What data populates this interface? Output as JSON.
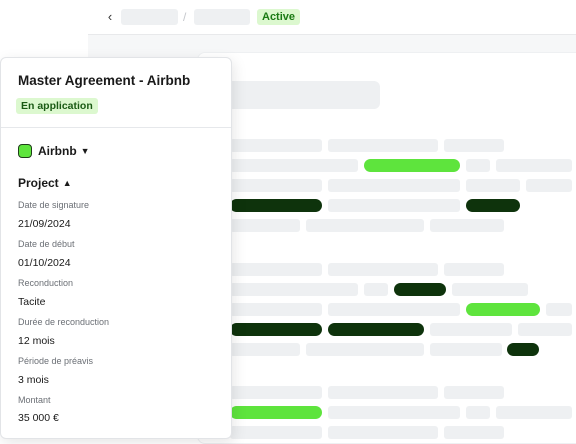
{
  "header": {
    "back_glyph": "‹",
    "breadcrumb_sep": "/",
    "status": "Active"
  },
  "panel": {
    "title": "Master Agreement - Airbnb",
    "badge": "En application",
    "company": {
      "name": "Airbnb",
      "icon": "company-logo-icon"
    },
    "section": {
      "label": "Project",
      "icon": "chevron-up-icon"
    },
    "fields": [
      {
        "label": "Date de signature",
        "value": "21/09/2024"
      },
      {
        "label": "Date de début",
        "value": "01/10/2024"
      },
      {
        "label": "Reconduction",
        "value": "Tacite"
      },
      {
        "label": "Durée de reconduction",
        "value": "12 mois"
      },
      {
        "label": "Période de préavis",
        "value": "3 mois"
      },
      {
        "label": "Montant",
        "value": "35 000 €"
      }
    ]
  },
  "colors": {
    "accent_green": "#5ee43d",
    "dark_green": "#0e330c",
    "badge_bg": "#dcf8cf",
    "placeholder": "#eef0f2"
  }
}
